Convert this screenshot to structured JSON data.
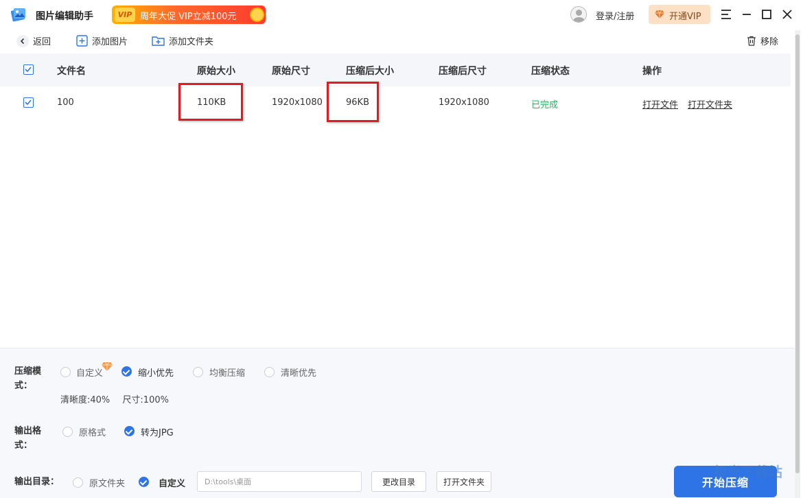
{
  "app": {
    "title": "图片编辑助手",
    "promo_badge": "VIP",
    "promo_text": "周年大促 VIP立减100元",
    "login_label": "登录/注册",
    "vip_button": "开通VIP"
  },
  "toolbar": {
    "back": "返回",
    "add_image": "添加图片",
    "add_folder": "添加文件夹",
    "remove": "移除"
  },
  "table": {
    "headers": [
      "文件名",
      "原始大小",
      "原始尺寸",
      "压缩后大小",
      "压缩后尺寸",
      "压缩状态",
      "操作"
    ],
    "rows": [
      {
        "name": "100",
        "orig_size": "110KB",
        "orig_dim": "1920x1080",
        "new_size": "96KB",
        "new_dim": "1920x1080",
        "status": "已完成",
        "action_open_file": "打开文件",
        "action_open_folder": "打开文件夹"
      }
    ]
  },
  "settings": {
    "mode_label": "压缩模式：",
    "mode_options": [
      "自定义",
      "缩小优先",
      "均衡压缩",
      "清晰优先"
    ],
    "mode_selected": "缩小优先",
    "clarity": "清晰度:40%",
    "size": "尺寸:100%",
    "format_label": "输出格式：",
    "format_options": [
      "原格式",
      "转为JPG"
    ],
    "format_selected": "转为JPG",
    "dir_label": "输出目录：",
    "dir_options": [
      "原文件夹",
      "自定义"
    ],
    "dir_selected": "自定义",
    "dir_value": "D:\\tools\\桌面",
    "change_dir": "更改目录",
    "open_folder": "打开文件夹",
    "start": "开始压缩"
  },
  "watermark": "极光下载站",
  "colors": {
    "accent": "#2f74e6",
    "status_done": "#27b360",
    "highlight": "#e01b24"
  }
}
